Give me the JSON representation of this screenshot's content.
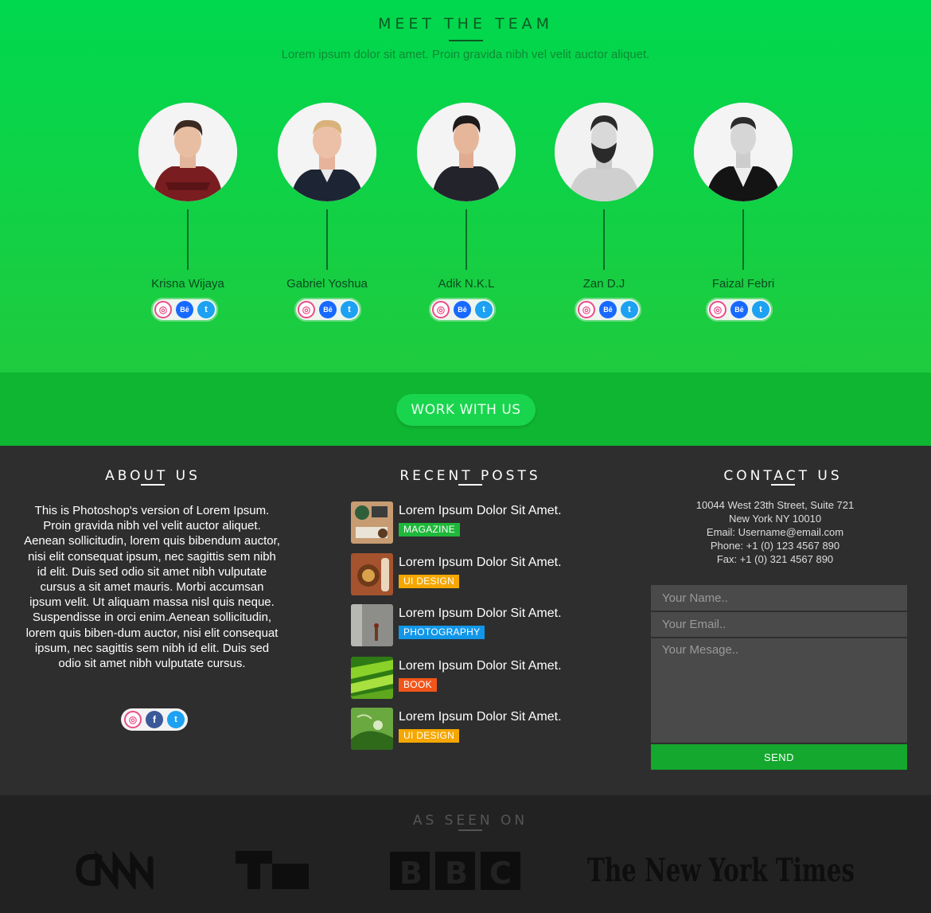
{
  "team": {
    "title": "MEET THE TEAM",
    "subtitle": "Lorem ipsum dolor sit amet. Proin gravida nibh vel velit auctor aliquet.",
    "members": [
      {
        "name": "Krisna Wijaya"
      },
      {
        "name": "Gabriel Yoshua"
      },
      {
        "name": "Adik N.K.L"
      },
      {
        "name": "Zan D.J"
      },
      {
        "name": "Faizal Febri"
      }
    ],
    "social_icons": [
      "dribbble-icon",
      "behance-icon",
      "twitter-icon"
    ]
  },
  "cta": {
    "label": "WORK WITH US"
  },
  "about": {
    "title": "ABOUT US",
    "text": "This is Photoshop's version  of Lorem Ipsum. Proin gravida nibh vel velit auctor aliquet. Aenean sollicitudin, lorem quis bibendum auctor, nisi elit consequat ipsum, nec sagittis sem nibh id elit. Duis sed odio sit amet nibh vulputate cursus a sit amet mauris. Morbi accumsan ipsum velit. Ut aliquam massa nisl quis neque. Suspendisse in orci enim.Aenean sollicitudin, lorem quis biben-dum auctor, nisi elit consequat ipsum, nec sagittis sem nibh id elit. Duis sed odio sit amet nibh vulputate cursus.",
    "social_icons": [
      "dribbble-icon",
      "facebook-icon",
      "twitter-icon"
    ]
  },
  "posts": {
    "title": "RECENT POSTS",
    "items": [
      {
        "title": "Lorem Ipsum Dolor Sit Amet.",
        "tag": "MAGAZINE",
        "tag_color": "#1fb83a"
      },
      {
        "title": "Lorem Ipsum Dolor Sit Amet.",
        "tag": "UI DESIGN",
        "tag_color": "#f5a700"
      },
      {
        "title": "Lorem Ipsum Dolor Sit Amet.",
        "tag": "PHOTOGRAPHY",
        "tag_color": "#1296e8"
      },
      {
        "title": "Lorem Ipsum Dolor Sit Amet.",
        "tag": "BOOK",
        "tag_color": "#f2551a"
      },
      {
        "title": "Lorem Ipsum Dolor Sit Amet.",
        "tag": "UI DESIGN",
        "tag_color": "#f5a700"
      }
    ]
  },
  "contact": {
    "title": "CONTACT US",
    "address1": "10044 West 23th Street, Suite 721",
    "address2": "New York NY 10010",
    "email": "Email: Username@email.com",
    "phone": "Phone: +1 (0) 123 4567 890",
    "fax": "Fax: +1 (0) 321 4567 890",
    "name_placeholder": "Your Name..",
    "email_placeholder": "Your Email..",
    "message_placeholder": "Your Mesage..",
    "send_label": "SEND"
  },
  "seen": {
    "title": "AS SEEN ON",
    "logos": [
      "CNN",
      "TC",
      "BBC",
      "The New York Times"
    ]
  },
  "colors": {
    "brand_green": "#00d84e",
    "cta_green": "#0fb632",
    "footer_bg": "#2e2e2e"
  }
}
